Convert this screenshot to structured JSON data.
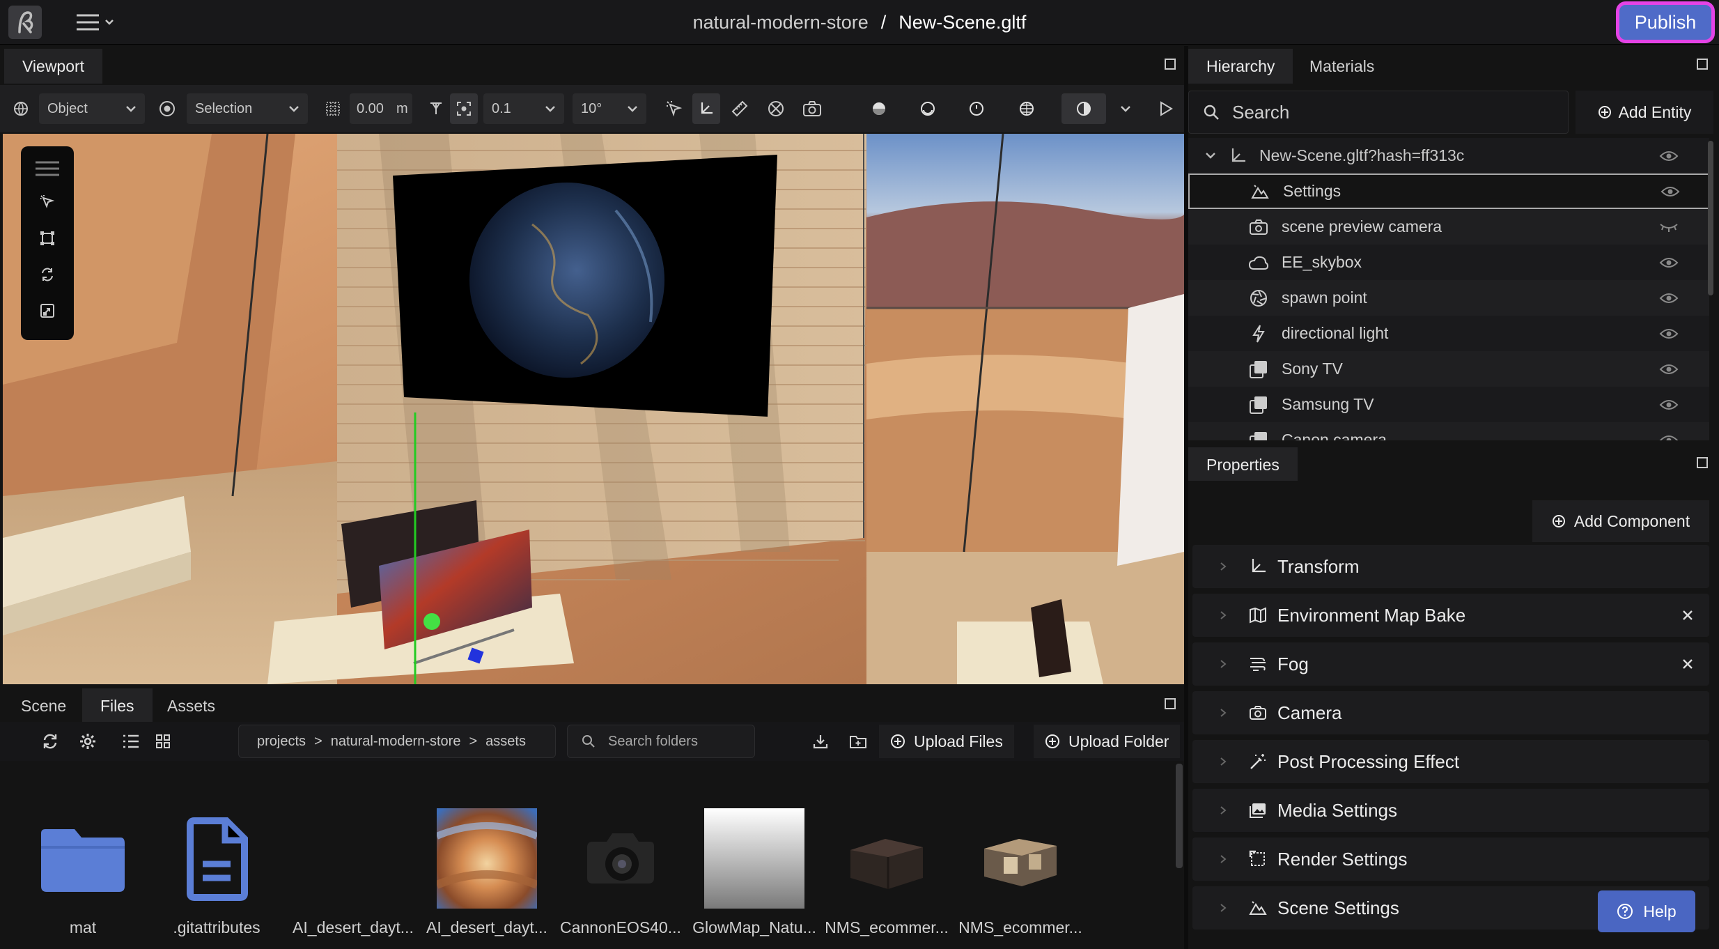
{
  "header": {
    "project_name": "natural-modern-store",
    "separator": "/",
    "scene_name": "New-Scene.gltf",
    "publish_label": "Publish"
  },
  "viewport": {
    "tab_label": "Viewport",
    "toolbar": {
      "transform_space": "Object",
      "pivot_mode": "Selection",
      "grid_value": "0.00",
      "grid_unit": "m",
      "translation_snap": "0.1",
      "rotation_snap": "10°"
    }
  },
  "bottom_panel": {
    "tabs": [
      "Scene",
      "Files",
      "Assets"
    ],
    "active_tab": "Files",
    "breadcrumb": [
      "projects",
      "natural-modern-store",
      "assets"
    ],
    "breadcrumb_sep": ">",
    "search_placeholder": "Search folders",
    "upload_files_label": "Upload Files",
    "upload_folder_label": "Upload Folder",
    "files": [
      {
        "name": "mat",
        "kind": "folder"
      },
      {
        "name": ".gitattributes",
        "kind": "document"
      },
      {
        "name": "AI_desert_dayt...",
        "kind": "blank"
      },
      {
        "name": "AI_desert_dayt...",
        "kind": "panorama"
      },
      {
        "name": "CannonEOS40...",
        "kind": "camera"
      },
      {
        "name": "GlowMap_Natu...",
        "kind": "gradient"
      },
      {
        "name": "NMS_ecommer...",
        "kind": "model-dark"
      },
      {
        "name": "NMS_ecommer...",
        "kind": "model-light"
      }
    ]
  },
  "hierarchy": {
    "tabs": [
      "Hierarchy",
      "Materials"
    ],
    "search_placeholder": "Search",
    "add_entity_label": "Add Entity",
    "root": "New-Scene.gltf?hash=ff313c",
    "items": [
      {
        "label": "Settings",
        "icon": "mountain-icon",
        "visible": true,
        "selected": true
      },
      {
        "label": "scene preview camera",
        "icon": "camera-icon",
        "visible": false
      },
      {
        "label": "EE_skybox",
        "icon": "cloud-icon",
        "visible": true
      },
      {
        "label": "spawn point",
        "icon": "aperture-icon",
        "visible": true
      },
      {
        "label": "directional light",
        "icon": "bolt-icon",
        "visible": true
      },
      {
        "label": "Sony TV",
        "icon": "model-icon",
        "visible": true
      },
      {
        "label": "Samsung TV",
        "icon": "model-icon",
        "visible": true
      },
      {
        "label": "Canon camera",
        "icon": "model-icon",
        "visible": true
      }
    ]
  },
  "properties": {
    "tab_label": "Properties",
    "add_component_label": "Add Component",
    "components": [
      {
        "label": "Transform",
        "icon": "axes-icon",
        "removable": false
      },
      {
        "label": "Environment Map Bake",
        "icon": "map-icon",
        "removable": true
      },
      {
        "label": "Fog",
        "icon": "fog-icon",
        "removable": true
      },
      {
        "label": "Camera",
        "icon": "camera-icon",
        "removable": false
      },
      {
        "label": "Post Processing Effect",
        "icon": "magic-wand-icon",
        "removable": false
      },
      {
        "label": "Media Settings",
        "icon": "image-icon",
        "removable": false
      },
      {
        "label": "Render Settings",
        "icon": "render-frame-icon",
        "removable": false
      },
      {
        "label": "Scene Settings",
        "icon": "mountain-icon",
        "removable": false
      }
    ]
  },
  "help_label": "Help",
  "colors": {
    "accent": "#4f6bc8",
    "publish_highlight": "#e443e6",
    "panel_bg": "#141414"
  }
}
